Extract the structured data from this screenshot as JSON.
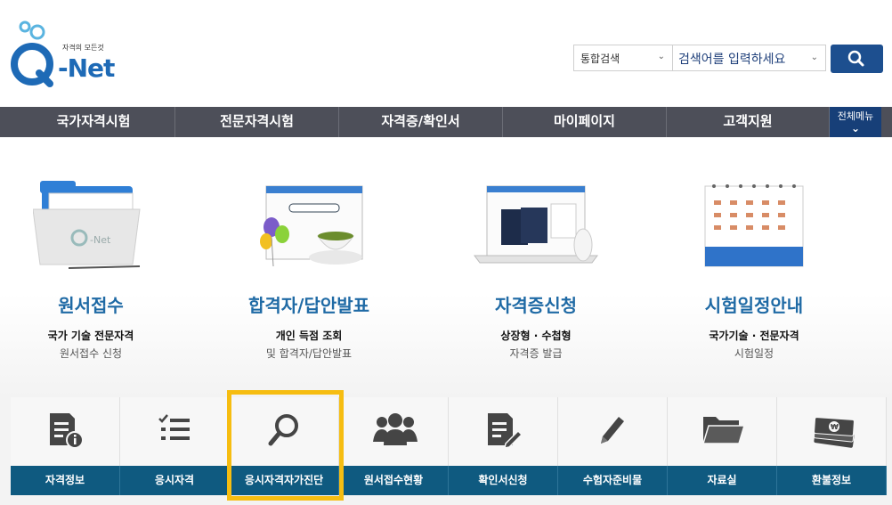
{
  "logo": {
    "tagline": "자격의 모든것",
    "brand": "-Net"
  },
  "search": {
    "scope": "통합검색",
    "placeholder": "검색어를 입력하세요"
  },
  "nav": {
    "items": [
      "국가자격시험",
      "전문자격시험",
      "자격증/확인서",
      "마이페이지",
      "고객지원"
    ],
    "all_menu": "전체메뉴"
  },
  "features": [
    {
      "title": "원서접수",
      "line1": "국가 기술 전문자격",
      "line2": "원서접수 신청"
    },
    {
      "title": "합격자/답안발표",
      "line1": "개인 득점 조회",
      "line2": "및 합격자/답안발표"
    },
    {
      "title": "자격증신청",
      "line1": "상장형 · 수첩형",
      "line2": "자격증 발급"
    },
    {
      "title": "시험일정안내",
      "line1": "국가기술 · 전문자격",
      "line2": "시험일정"
    }
  ],
  "quick_menu": [
    {
      "label": "자격정보",
      "icon": "document-info-icon"
    },
    {
      "label": "응시자격",
      "icon": "checklist-icon"
    },
    {
      "label": "응시자격자가진단",
      "icon": "magnifier-icon"
    },
    {
      "label": "원서접수현황",
      "icon": "people-group-icon"
    },
    {
      "label": "확인서신청",
      "icon": "document-edit-icon"
    },
    {
      "label": "수험자준비물",
      "icon": "pencil-icon"
    },
    {
      "label": "자료실",
      "icon": "folder-icon"
    },
    {
      "label": "환불정보",
      "icon": "money-stack-icon"
    }
  ],
  "colors": {
    "nav_bg": "#4d4f59",
    "accent_blue": "#1f6aa5",
    "quick_bar": "#0f5a80",
    "highlight": "#f6bd11"
  }
}
